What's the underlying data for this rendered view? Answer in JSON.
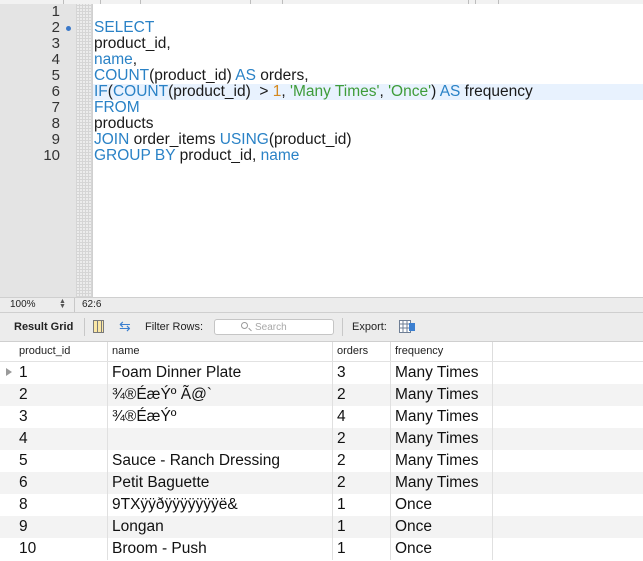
{
  "editor": {
    "line_numbers": [
      "1",
      "2",
      "3",
      "4",
      "5",
      "6",
      "7",
      "8",
      "9",
      "10"
    ],
    "status": {
      "zoom": "100%",
      "cursor_position": "62:6"
    }
  },
  "result_toolbar": {
    "tab_label": "Result Grid",
    "filter_label": "Filter Rows:",
    "search_placeholder": "Search",
    "export_label": "Export:"
  },
  "result_grid": {
    "columns": [
      "product_id",
      "name",
      "orders",
      "frequency"
    ],
    "rows": [
      {
        "product_id": "1",
        "name": "Foam Dinner Plate",
        "orders": "3",
        "frequency": "Many Times"
      },
      {
        "product_id": "2",
        "name": "¾®ÉæÝº Ã@`",
        "orders": "2",
        "frequency": "Many Times"
      },
      {
        "product_id": "3",
        "name": "¾®ÉæÝº",
        "orders": "4",
        "frequency": "Many Times"
      },
      {
        "product_id": "4",
        "name": "",
        "orders": "2",
        "frequency": "Many Times"
      },
      {
        "product_id": "5",
        "name": "Sauce - Ranch Dressing",
        "orders": "2",
        "frequency": "Many Times"
      },
      {
        "product_id": "6",
        "name": "Petit Baguette",
        "orders": "2",
        "frequency": "Many Times"
      },
      {
        "product_id": "8",
        "name": "9TXÿÿðÿÿÿÿÿÿÿë&",
        "orders": "1",
        "frequency": "Once"
      },
      {
        "product_id": "9",
        "name": "Longan",
        "orders": "1",
        "frequency": "Once"
      },
      {
        "product_id": "10",
        "name": "Broom - Push",
        "orders": "1",
        "frequency": "Once"
      }
    ]
  },
  "colors": {
    "keyword": "#2a82c6",
    "string": "#3f9c3a",
    "number": "#d4891f"
  }
}
